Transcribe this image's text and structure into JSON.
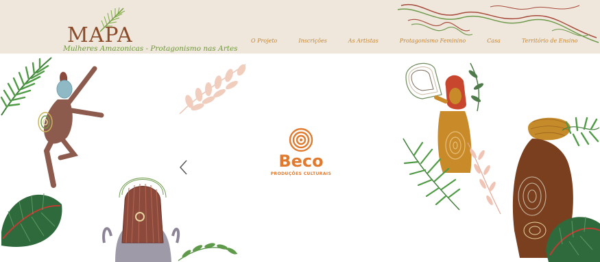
{
  "header": {
    "logo_title": "MAPA",
    "logo_subtitle": "Mulheres Amazonicas - Protagonismo nas Artes",
    "nav": [
      "O Projeto",
      "Inscrições",
      "As Artistas",
      "Protagonismo Feminino",
      "Casa",
      "Território de Ensino"
    ]
  },
  "slide": {
    "brand_name": "Beco",
    "brand_tagline": "PRODUÇÕES CULTURAIS"
  },
  "colors": {
    "header_bg": "#efe6dc",
    "logo_brown": "#8a4b2a",
    "logo_green": "#6a9a34",
    "nav_gold": "#c4862f",
    "brand_orange": "#e07a2f"
  },
  "icons": {
    "prev": "chevron-left-icon",
    "brand": "concentric-circles-icon"
  }
}
